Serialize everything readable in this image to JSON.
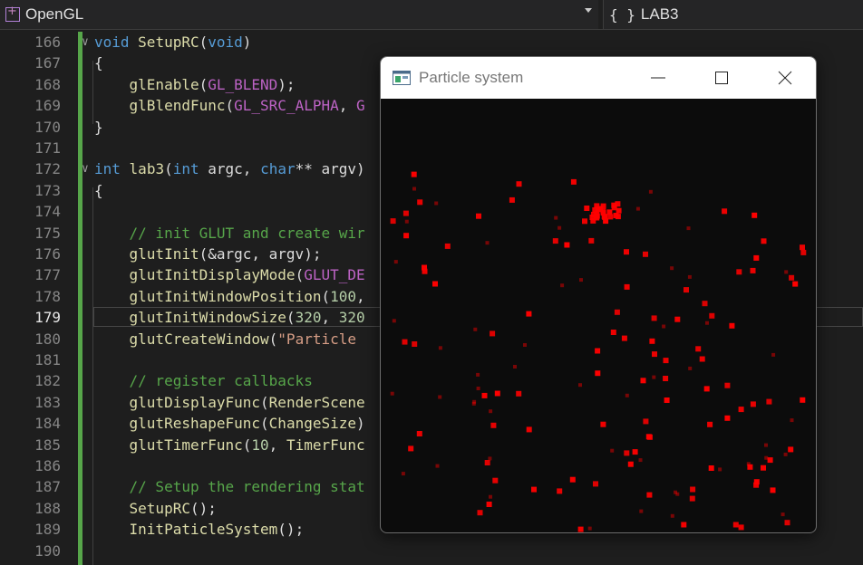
{
  "topbar": {
    "project_label": "OpenGL",
    "scope_icon": "{ }",
    "scope_label": "LAB3"
  },
  "editor": {
    "active_line": "179",
    "lines": [
      {
        "n": "166",
        "fold": true,
        "tokens": [
          [
            "kw",
            "void"
          ],
          [
            "pun",
            " "
          ],
          [
            "fn",
            "SetupRC"
          ],
          [
            "pun",
            "("
          ],
          [
            "kw",
            "void"
          ],
          [
            "pun",
            ")"
          ]
        ]
      },
      {
        "n": "167",
        "tokens": [
          [
            "pun",
            "{"
          ]
        ]
      },
      {
        "n": "168",
        "tokens": [
          [
            "pun",
            "    "
          ],
          [
            "fn",
            "glEnable"
          ],
          [
            "pun",
            "("
          ],
          [
            "mac",
            "GL_BLEND"
          ],
          [
            "pun",
            ");"
          ]
        ]
      },
      {
        "n": "169",
        "tokens": [
          [
            "pun",
            "    "
          ],
          [
            "fn",
            "glBlendFunc"
          ],
          [
            "pun",
            "("
          ],
          [
            "mac",
            "GL_SRC_ALPHA"
          ],
          [
            "pun",
            ", "
          ],
          [
            "mac",
            "G"
          ]
        ]
      },
      {
        "n": "170",
        "tokens": [
          [
            "pun",
            "}"
          ]
        ]
      },
      {
        "n": "171",
        "tokens": []
      },
      {
        "n": "172",
        "fold": true,
        "tokens": [
          [
            "kw",
            "int"
          ],
          [
            "pun",
            " "
          ],
          [
            "fn",
            "lab3"
          ],
          [
            "pun",
            "("
          ],
          [
            "kw",
            "int"
          ],
          [
            "pun",
            " argc, "
          ],
          [
            "kw",
            "char"
          ],
          [
            "pun",
            "** argv)"
          ]
        ]
      },
      {
        "n": "173",
        "tokens": [
          [
            "pun",
            "{"
          ]
        ]
      },
      {
        "n": "174",
        "tokens": []
      },
      {
        "n": "175",
        "tokens": [
          [
            "pun",
            "    "
          ],
          [
            "cmt",
            "// init GLUT and create wir"
          ]
        ]
      },
      {
        "n": "176",
        "tokens": [
          [
            "pun",
            "    "
          ],
          [
            "fn",
            "glutInit"
          ],
          [
            "pun",
            "(&argc, argv);"
          ]
        ]
      },
      {
        "n": "177",
        "tokens": [
          [
            "pun",
            "    "
          ],
          [
            "fn",
            "glutInitDisplayMode"
          ],
          [
            "pun",
            "("
          ],
          [
            "mac",
            "GLUT_DE"
          ]
        ]
      },
      {
        "n": "178",
        "tokens": [
          [
            "pun",
            "    "
          ],
          [
            "fn",
            "glutInitWindowPosition"
          ],
          [
            "pun",
            "("
          ],
          [
            "num",
            "100"
          ],
          [
            "pun",
            ","
          ]
        ]
      },
      {
        "n": "179",
        "tokens": [
          [
            "pun",
            "    "
          ],
          [
            "fn",
            "glutInitWindowSize"
          ],
          [
            "pun",
            "("
          ],
          [
            "num",
            "320"
          ],
          [
            "pun",
            ", "
          ],
          [
            "num",
            "320"
          ]
        ]
      },
      {
        "n": "180",
        "tokens": [
          [
            "pun",
            "    "
          ],
          [
            "fn",
            "glutCreateWindow"
          ],
          [
            "pun",
            "("
          ],
          [
            "str",
            "\"Particle "
          ]
        ]
      },
      {
        "n": "181",
        "tokens": []
      },
      {
        "n": "182",
        "tokens": [
          [
            "pun",
            "    "
          ],
          [
            "cmt",
            "// register callbacks"
          ]
        ]
      },
      {
        "n": "183",
        "tokens": [
          [
            "pun",
            "    "
          ],
          [
            "fn",
            "glutDisplayFunc"
          ],
          [
            "pun",
            "("
          ],
          [
            "fn",
            "RenderScene"
          ]
        ]
      },
      {
        "n": "184",
        "tokens": [
          [
            "pun",
            "    "
          ],
          [
            "fn",
            "glutReshapeFunc"
          ],
          [
            "pun",
            "("
          ],
          [
            "fn",
            "ChangeSize"
          ],
          [
            "pun",
            ")"
          ]
        ]
      },
      {
        "n": "185",
        "tokens": [
          [
            "pun",
            "    "
          ],
          [
            "fn",
            "glutTimerFunc"
          ],
          [
            "pun",
            "("
          ],
          [
            "num",
            "10"
          ],
          [
            "pun",
            ", "
          ],
          [
            "fn",
            "TimerFunc"
          ]
        ]
      },
      {
        "n": "186",
        "tokens": []
      },
      {
        "n": "187",
        "tokens": [
          [
            "pun",
            "    "
          ],
          [
            "cmt",
            "// Setup the rendering stat"
          ]
        ]
      },
      {
        "n": "188",
        "tokens": [
          [
            "pun",
            "    "
          ],
          [
            "fn",
            "SetupRC"
          ],
          [
            "pun",
            "();"
          ]
        ]
      },
      {
        "n": "189",
        "tokens": [
          [
            "pun",
            "    "
          ],
          [
            "fn",
            "InitPaticleSystem"
          ],
          [
            "pun",
            "();"
          ]
        ]
      },
      {
        "n": "190",
        "tokens": []
      }
    ]
  },
  "window": {
    "title": "Particle system",
    "particle_color": "#ff0000",
    "background_color": "#0c0c0c"
  },
  "colors": {
    "keyword": "#569cd6",
    "function": "#dcdcaa",
    "macro": "#bd63c5",
    "number": "#b5cea8",
    "string": "#d69d85",
    "comment": "#57a64a"
  }
}
